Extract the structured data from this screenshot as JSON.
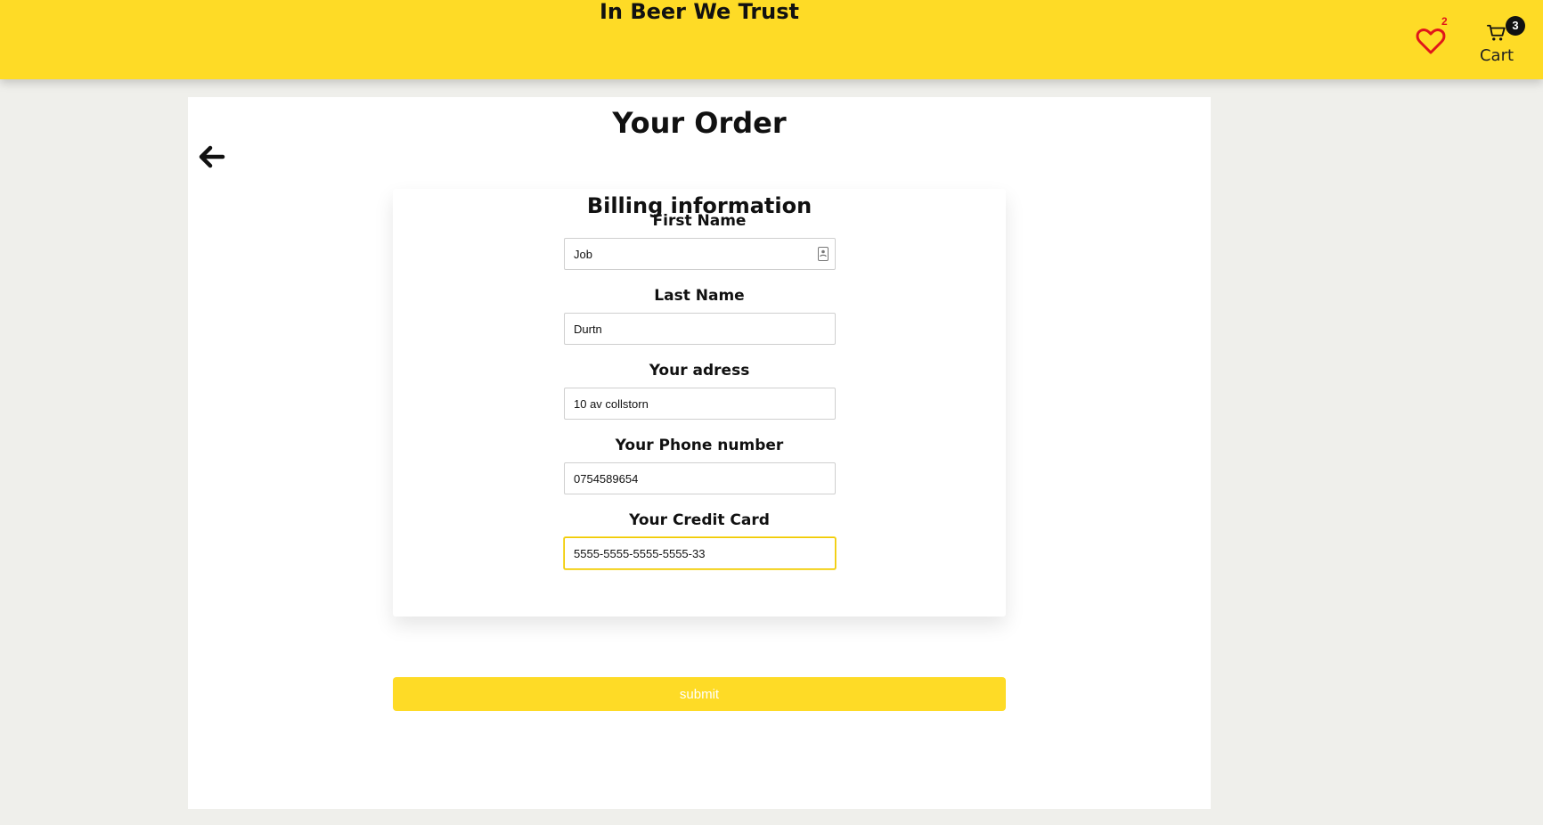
{
  "header": {
    "site_title": "In Beer We Trust",
    "favorites_count": "2",
    "cart_count": "3",
    "cart_label": "Cart"
  },
  "page": {
    "title": "Your Order"
  },
  "billing": {
    "title": "Billing information",
    "fields": [
      {
        "label": "First Name",
        "value": "Job"
      },
      {
        "label": "Last Name",
        "value": "Durtn"
      },
      {
        "label": "Your adress",
        "value": "10 av collstorn"
      },
      {
        "label": "Your Phone number",
        "value": "0754589654"
      },
      {
        "label": "Your Credit Card",
        "value": "5555-5555-5555-5555-33"
      }
    ],
    "submit_label": "submit"
  },
  "colors": {
    "brand_yellow": "#fedb26",
    "favorites_red": "#e0161a",
    "background": "#efefeb"
  },
  "icons": [
    "heart-icon",
    "cart-icon",
    "back-arrow-icon",
    "autofill-contact-icon"
  ]
}
